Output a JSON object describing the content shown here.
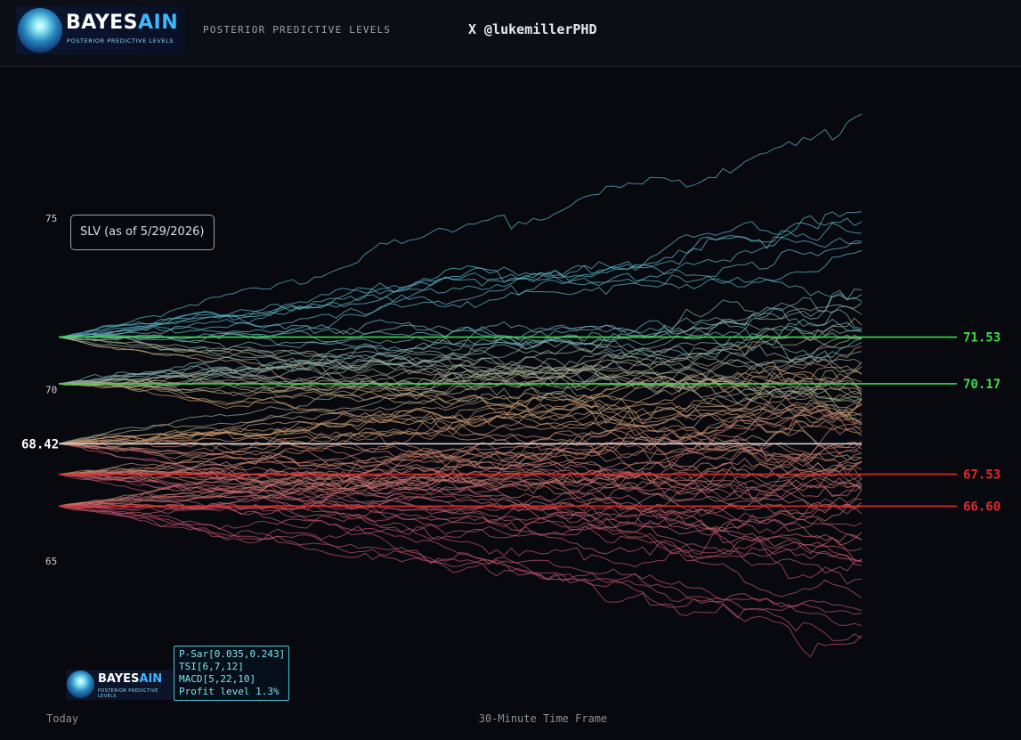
{
  "header": {
    "logo_title_main": "BAYES",
    "logo_title_accent": "AIN",
    "logo_subtitle": "POSTERIOR PREDICTIVE LEVELS",
    "label": "POSTERIOR PREDICTIVE LEVELS",
    "handle": "X @lukemillerPHD"
  },
  "annotation": "SLV (as of 5/29/2026)",
  "indicators": [
    "P-Sar[0.035,0.243]",
    "TSI[6,7,12]",
    "MACD[5,22,10]",
    "Profit level 1.3%"
  ],
  "colors": {
    "background": "#07090f",
    "upper_level": "#3ddb4a",
    "lower_level": "#e02a2a",
    "current_level": "#d9d9d9",
    "path_high": "#5fb8c8",
    "path_mid": "#c8a070",
    "path_low": "#c0506a"
  },
  "chart_data": {
    "type": "line",
    "title": "",
    "xlabel": "30-Minute Time Frame",
    "x_start_label": "Today",
    "ylabel": "",
    "yticks": [
      65,
      70,
      75
    ],
    "ylim": [
      62.0,
      78.4
    ],
    "grid": false,
    "current_price": {
      "value": 68.42,
      "label": "68.42"
    },
    "levels": [
      {
        "value": 71.53,
        "label": "71.53",
        "kind": "resistance",
        "color": "#3ddb4a"
      },
      {
        "value": 70.17,
        "label": "70.17",
        "kind": "resistance",
        "color": "#3ddb4a"
      },
      {
        "value": 67.53,
        "label": "67.53",
        "kind": "support",
        "color": "#e02a2a"
      },
      {
        "value": 66.6,
        "label": "66.60",
        "kind": "support",
        "color": "#e02a2a"
      }
    ],
    "simulated_paths": {
      "per_start_count": 20,
      "steps": 110,
      "end_range": [
        63.3,
        77.3
      ]
    }
  }
}
